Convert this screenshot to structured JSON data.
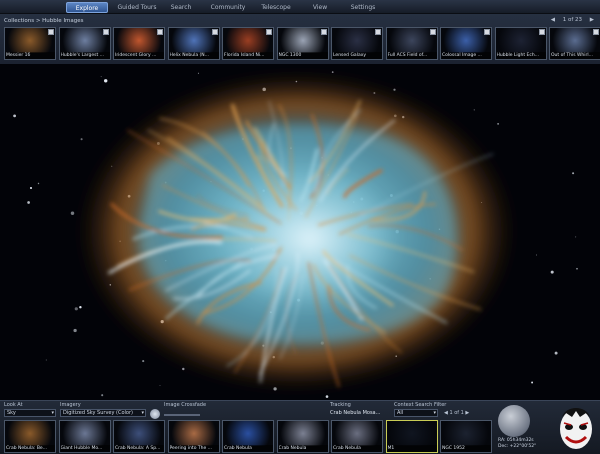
{
  "nav": {
    "tabs": [
      {
        "label": "Explore",
        "active": true
      },
      {
        "label": "Guided Tours",
        "active": false
      },
      {
        "label": "Search",
        "active": false
      },
      {
        "label": "Community",
        "active": false
      },
      {
        "label": "Telescope",
        "active": false
      },
      {
        "label": "View",
        "active": false
      },
      {
        "label": "Settings",
        "active": false
      }
    ]
  },
  "explore": {
    "breadcrumb": "Collections > Hubble Images",
    "page": "1 of 23",
    "thumbnails": [
      {
        "label": "Messier 16",
        "color": "#8a5a2a"
      },
      {
        "label": "Hubble's Largest ...",
        "color": "#6d7ea0"
      },
      {
        "label": "Iridescent Glory ...",
        "color": "#c0562e"
      },
      {
        "label": "Helix Nebula (N...",
        "color": "#4f73b8"
      },
      {
        "label": "Florida Island Ni...",
        "color": "#9a3e22"
      },
      {
        "label": "NGC 1300",
        "color": "#9aa3b4"
      },
      {
        "label": "Lensed Galaxy",
        "color": "#2a2f44"
      },
      {
        "label": "Full ACS Field of...",
        "color": "#3c455c"
      },
      {
        "label": "Colossal Image ...",
        "color": "#3b5fa8"
      },
      {
        "label": "Hubble Light Ech...",
        "color": "#1d2233"
      },
      {
        "label": "Out of This Whirl...",
        "color": "#5a6c90"
      }
    ]
  },
  "bottom": {
    "look_at_label": "Look At",
    "look_at_value": "Sky",
    "imagery_label": "Imagery",
    "imagery_value": "Digitized Sky Survey (Color)",
    "image_crossfade_label": "Image Crossfade",
    "tracking_label": "Tracking",
    "tracking_value": "Crab Nebula Mosa...",
    "context_filter_label": "Context Search Filter",
    "context_filter_value": "All",
    "context_page": "1 of 1",
    "context_items": [
      {
        "label": "Crab Nebula: Be...",
        "color": "#8a5a2a",
        "highlight": false
      },
      {
        "label": "Giant Hubble Mo...",
        "color": "#6b7794",
        "highlight": false
      },
      {
        "label": "Crab Nebula: A Sp...",
        "color": "#3d4f7a",
        "highlight": false
      },
      {
        "label": "Peering into The ...",
        "color": "#a86a44",
        "highlight": false
      },
      {
        "label": "Crab Nebula",
        "color": "#2a4fa0",
        "highlight": false
      },
      {
        "label": "Crab Nebula",
        "color": "#7b8092",
        "highlight": false
      },
      {
        "label": "Crab Nebula",
        "color": "#6a6e80",
        "highlight": false
      },
      {
        "label": "M1",
        "color": "#101520",
        "highlight": true
      },
      {
        "label": "NGC 1952",
        "color": "#1c2230",
        "highlight": false
      }
    ],
    "coords": {
      "ra": "RA: 05h34m32s",
      "dec": "Dec: +22°00'52\""
    }
  },
  "colors": {
    "accent": "#4f78b8",
    "panel": "#1b2230",
    "nebula_core": "#9fd8e8",
    "nebula_filament": "#d08a3a"
  }
}
